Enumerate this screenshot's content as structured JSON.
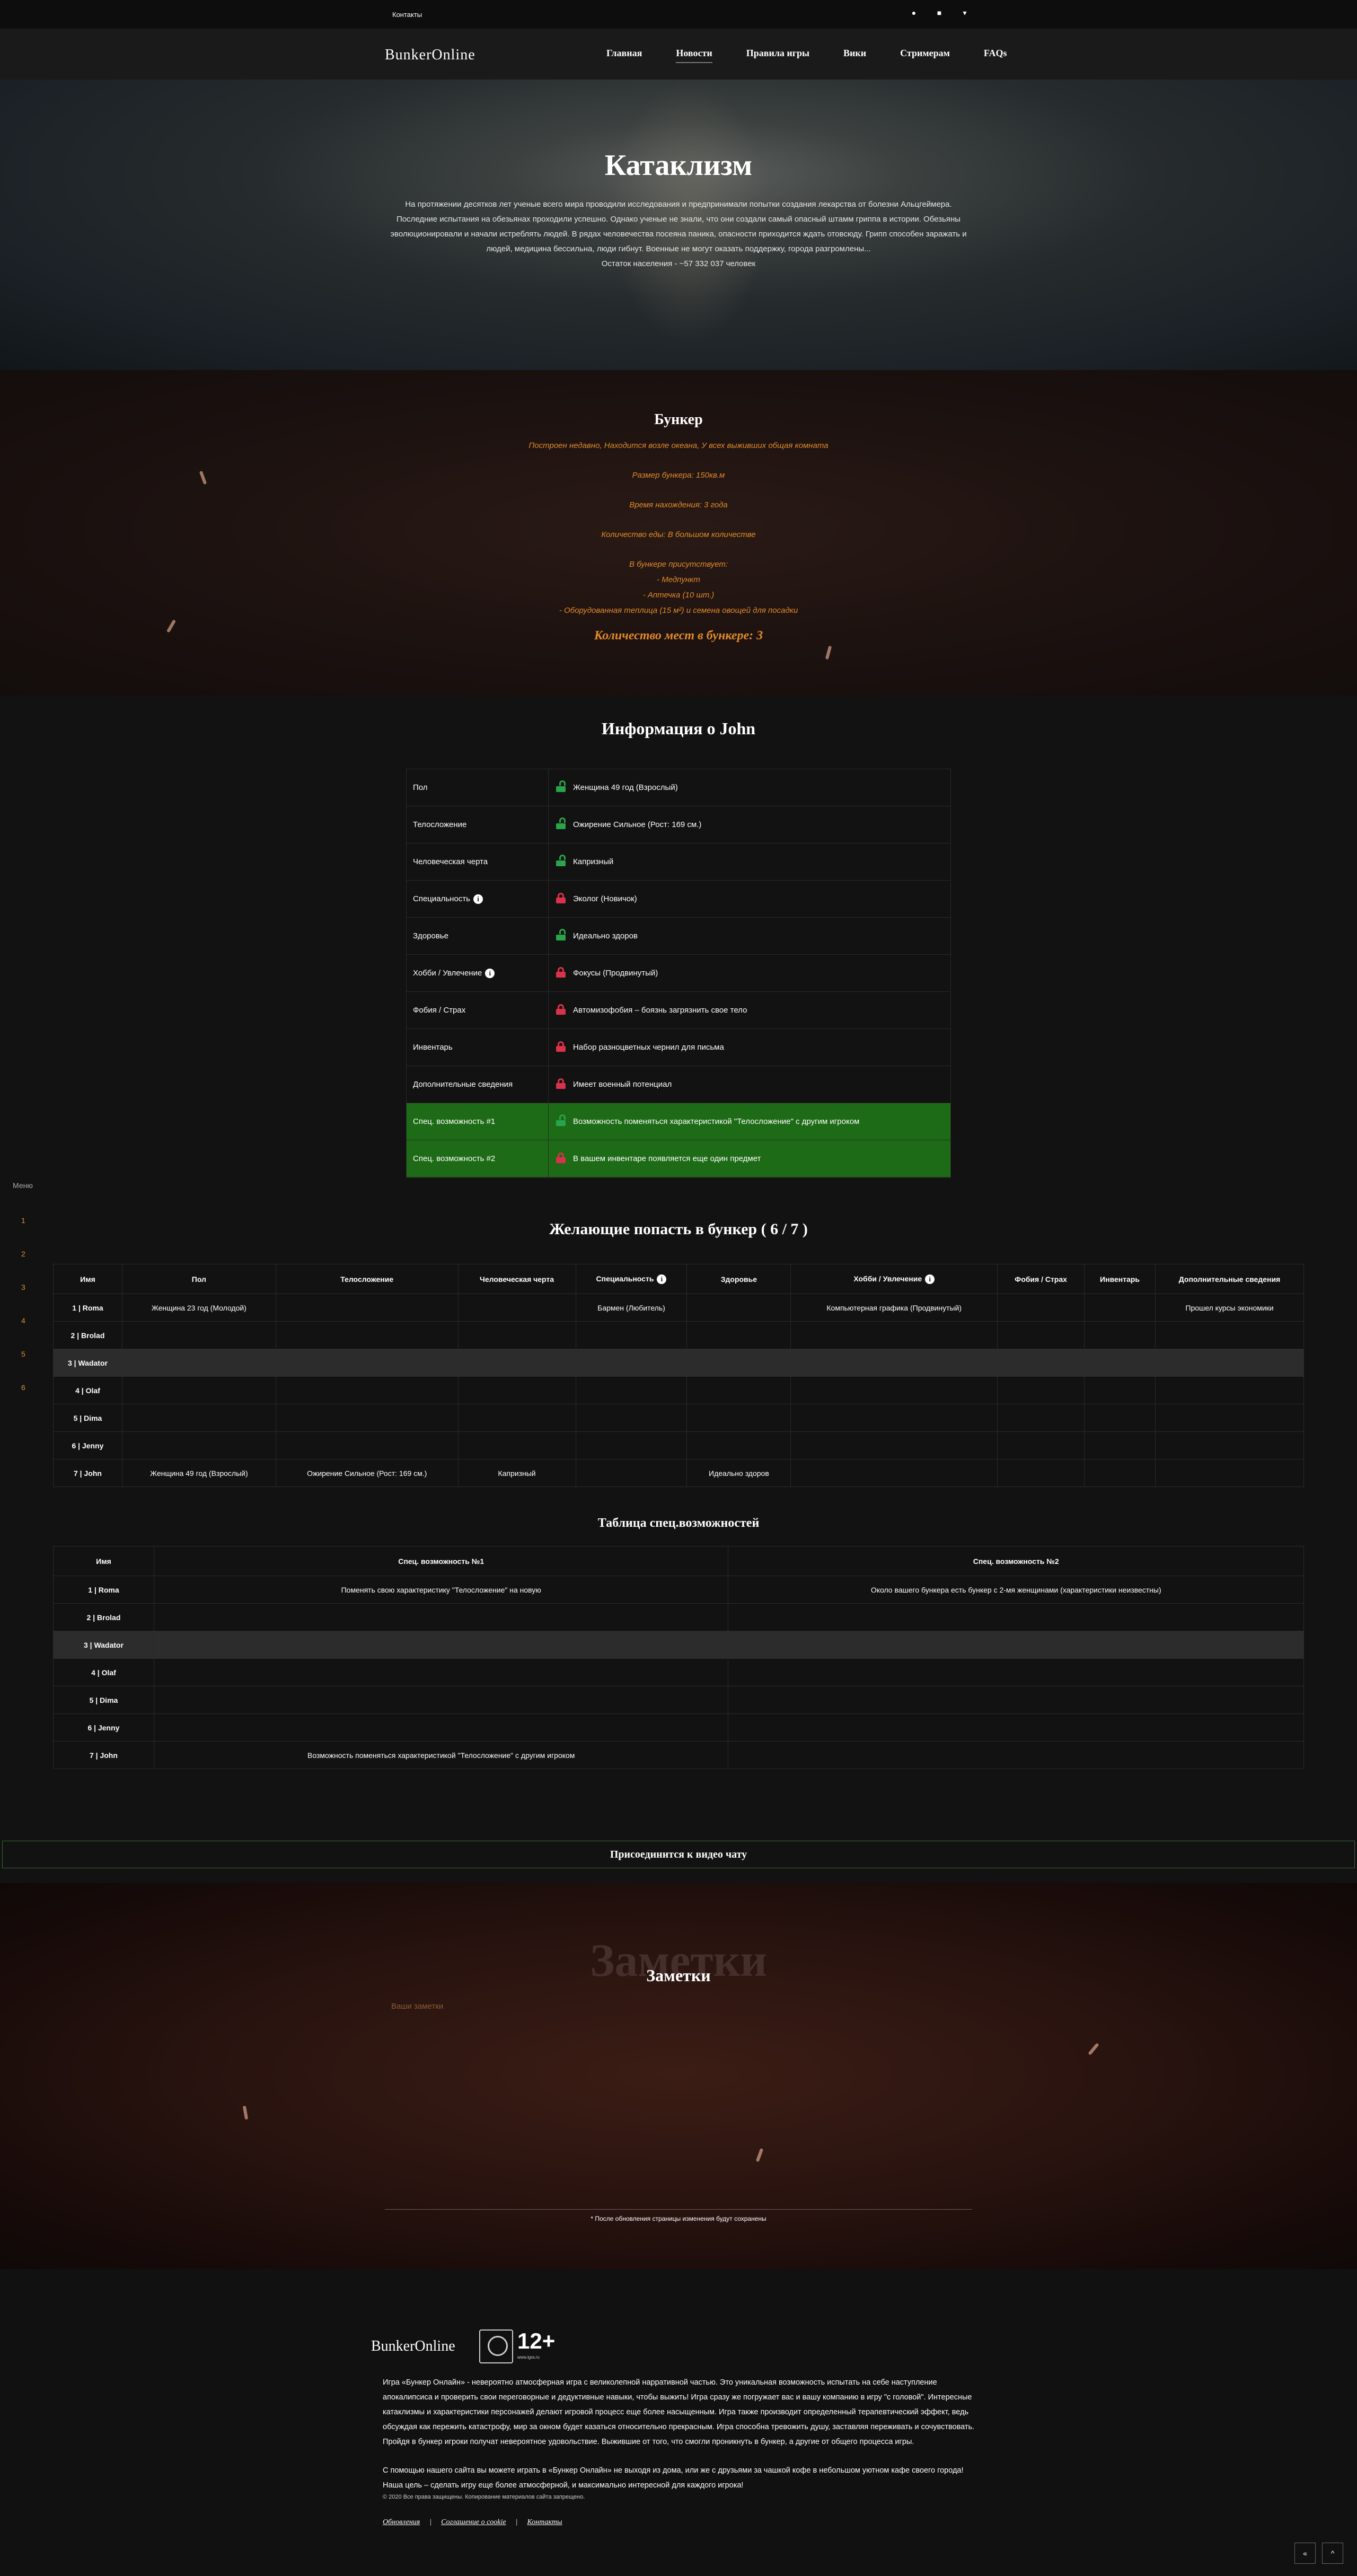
{
  "topbar": {
    "contacts": "Контакты"
  },
  "header": {
    "logo": "BunkerOnline",
    "nav": [
      "Главная",
      "Новости",
      "Правила игры",
      "Вики",
      "Стримерам",
      "FAQs"
    ]
  },
  "hero": {
    "title": "Катаклизм",
    "text": "На протяжении десятков лет ученые всего мира проводили исследования и предпринимали попытки создания лекарства от болезни Альцгеймера. Последние испытания на обезьянах проходили успешно. Однако ученые не знали, что они создали самый опасный штамм гриппа в истории. Обезьяны эволюционировали и начали истреблять людей. В рядах человечества посеяна паника, опасности приходится ждать отовсюду. Грипп способен заражать и людей, медицина бессильна, люди гибнут. Военные не могут оказать поддержку, города разгромлены...",
    "population": "Остаток населения - ~57 332 037 человек"
  },
  "bunker": {
    "title": "Бункер",
    "built": "Построен недавно, Находится возле океана, У всех выживших общая комната",
    "size": "Размер бункера: 150кв.м",
    "time": "Время нахождения: 3 года",
    "food": "Количество еды: В большом количестве",
    "present_label": "В бункере присутствует:",
    "items": [
      "- Медпункт",
      "- Аптечка (10 шт.)",
      "- Оборудованная теплица (15 м²) и семена овощей для посадки"
    ],
    "places": "Количество мест в бункере: 3"
  },
  "info": {
    "title": "Информация о John",
    "rows": [
      {
        "key": "Пол",
        "value": "Женщина 49 год (Взрослый)",
        "lock": "open"
      },
      {
        "key": "Телосложение",
        "value": "Ожирение Сильное (Рост: 169 см.)",
        "lock": "open"
      },
      {
        "key": "Человеческая черта",
        "value": "Капризный",
        "lock": "open"
      },
      {
        "key": "Специальность",
        "value": "Эколог (Новичок)",
        "lock": "closed"
      },
      {
        "key": "Здоровье",
        "value": "Идеально здоров",
        "lock": "open"
      },
      {
        "key": "Хобби / Увлечение",
        "value": "Фокусы (Продвинутый)",
        "lock": "closed"
      },
      {
        "key": "Фобия / Страх",
        "value": "Автомизофобия – боязнь загрязнить свое тело",
        "lock": "closed"
      },
      {
        "key": "Инвентарь",
        "value": "Набор разноцветных чернил для письма",
        "lock": "closed"
      },
      {
        "key": "Дополнительные сведения",
        "value": "Имеет военный потенциал",
        "lock": "closed"
      },
      {
        "key": "Спец. возможность #1",
        "value": "Возможность поменяться характеристикой \"Телосложение\" с другим игроком",
        "lock": "open"
      },
      {
        "key": "Спец. возможность #2",
        "value": "В вашем инвентаре появляется еще один предмет",
        "lock": "closed"
      }
    ]
  },
  "side_menu": {
    "label": "Меню",
    "items": [
      "1",
      "2",
      "3",
      "4",
      "5",
      "6"
    ]
  },
  "players": {
    "title": "Желающие попасть в бункер ( 6 / 7 )",
    "columns": [
      "Имя",
      "Пол",
      "Телосложение",
      "Человеческая черта",
      "Специальность",
      "Здоровье",
      "Хобби / Увлечение",
      "Фобия / Страх",
      "Инвентарь",
      "Дополнительные сведения"
    ],
    "rows": [
      [
        "1 | Roma",
        "Женщина 23 год (Молодой)",
        "",
        "",
        "Бармен (Любитель)",
        "",
        "Компьютерная графика (Продвинутый)",
        "",
        "",
        "Прошел курсы экономики"
      ],
      [
        "2 | Brolad",
        "",
        "",
        "",
        "",
        "",
        "",
        "",
        "",
        ""
      ],
      [
        "3 | Wadator",
        "",
        "",
        "",
        "",
        "",
        "",
        "",
        "",
        ""
      ],
      [
        "4 | Olaf",
        "",
        "",
        "",
        "",
        "",
        "",
        "",
        "",
        ""
      ],
      [
        "5 | Dima",
        "",
        "",
        "",
        "",
        "",
        "",
        "",
        "",
        ""
      ],
      [
        "6 | Jenny",
        "",
        "",
        "",
        "",
        "",
        "",
        "",
        "",
        ""
      ],
      [
        "7 | John",
        "Женщина 49 год (Взрослый)",
        "Ожирение Сильное (Рост: 169 см.)",
        "Капризный",
        "",
        "Идеально здоров",
        "",
        "",
        "",
        ""
      ]
    ]
  },
  "abilities": {
    "title": "Таблица спец.возможностей",
    "columns": [
      "Имя",
      "Спец. возможность №1",
      "Спец. возможность №2"
    ],
    "rows": [
      [
        "1 | Roma",
        "Поменять свою характеристику \"Телосложение\" на новую",
        "Около вашего бункера есть бункер с 2-мя женщинами (характеристики неизвестны)"
      ],
      [
        "2 | Brolad",
        "",
        ""
      ],
      [
        "3 | Wadator",
        "",
        ""
      ],
      [
        "4 | Olaf",
        "",
        ""
      ],
      [
        "5 | Dima",
        "",
        ""
      ],
      [
        "6 | Jenny",
        "",
        ""
      ],
      [
        "7 | John",
        "Возможность поменяться характеристикой \"Телосложение\" с другим игроком",
        ""
      ]
    ]
  },
  "video_chat": {
    "label": "Присоединится к видео чату"
  },
  "notes": {
    "ghost": "Заметки",
    "title": "Заметки",
    "placeholder": "Ваши заметки",
    "hint": "* После обновления страницы изменения будут сохранены"
  },
  "footer": {
    "logo": "BunkerOnline",
    "age": "12+",
    "age_sub": "www.igra.ru",
    "text1": "Игра «Бункер Онлайн» - невероятно атмосферная игра с великолепной нарративной частью. Это уникальная возможность испытать на себе наступление апокалипсиса и проверить свои переговорные и дедуктивные навыки, чтобы выжить! Игра сразу же погружает вас и вашу компанию в игру \"с головой\". Интересные катаклизмы и характеристики персонажей делают игровой процесс еще более насыщенным. Игра также производит определенный терапевтический эффект, ведь обсуждая как пережить катастрофу, мир за окном будет казаться относительно прекрасным. Игра способна тревожить душу, заставляя переживать и сочувствовать. Пройдя в бункер игроки получат невероятное удовольствие. Выжившие от того, что смогли проникнуть в бункер, а другие от общего процесса игры.",
    "text2": "С помощью нашего сайта вы можете играть в «Бункер Онлайн» не выходя из дома, или же с друзьями за чашкой кофе в небольшом уютном кафе своего города! Наша цель – сделать игру еще более атмосферной, и максимально интересной для каждого игрока!",
    "copyright": "© 2020 Все права защищены. Копирование материалов сайта запрещено.",
    "links": [
      "Обновления",
      "Соглашение о cookie",
      "Контакты"
    ],
    "sep": "|",
    "buttons": [
      "«",
      "^"
    ]
  },
  "colors": {
    "accent_orange": "#e08a28",
    "green_row": "#1d6b16",
    "lock_green": "#2aa44a",
    "lock_red": "#d9324a"
  }
}
